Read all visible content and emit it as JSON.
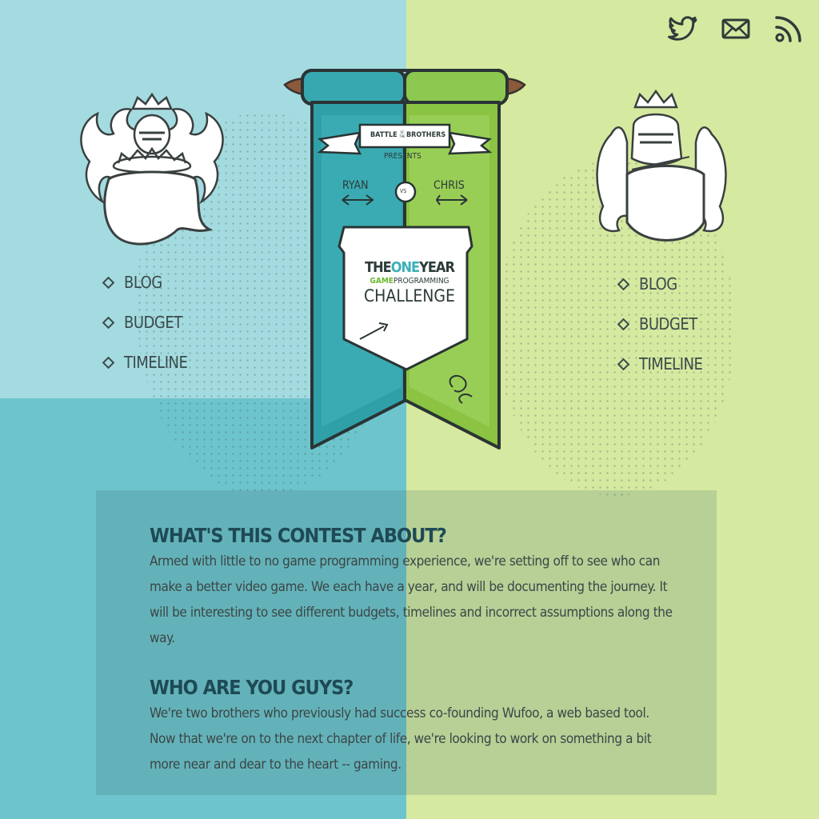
{
  "colors": {
    "teal_light": "#a4dbe0",
    "teal": "#6ec4cc",
    "lime": "#d6e9a0",
    "ink": "#3a4a4a",
    "heading": "#1e4a55"
  },
  "social": [
    {
      "icon": "twitter-icon"
    },
    {
      "icon": "mail-icon"
    },
    {
      "icon": "rss-icon"
    }
  ],
  "left_nav": [
    "BLOG",
    "BUDGET",
    "TIMELINE"
  ],
  "right_nav": [
    "BLOG",
    "BUDGET",
    "TIMELINE"
  ],
  "banner": {
    "ribbon_top": "BATTLE",
    "ribbon_small": "OF THE",
    "ribbon_end": "BROTHERS",
    "presents": "PRESENTS",
    "player_left": "RYAN",
    "vs": "VS",
    "player_right": "CHRIS",
    "title_the": "THE",
    "title_one": "ONE",
    "title_year": "YEAR",
    "title_game": "GAME",
    "title_programming": "PROGRAMMING",
    "title_challenge": "CHALLENGE"
  },
  "sections": [
    {
      "heading": "WHAT'S THIS CONTEST ABOUT?",
      "body": "Armed with little to no game programming experience, we're setting off to see who can make a better video game. We each have a year, and will be documenting the journey. It will be interesting to see different budgets, timelines and incorrect assumptions along the way."
    },
    {
      "heading": "WHO ARE YOU GUYS?",
      "body": "We're two brothers who previously had success co-founding Wufoo, a web based tool. Now that we're on to the next chapter of life, we're looking to work on something a bit more near and dear to the heart -- gaming."
    }
  ]
}
